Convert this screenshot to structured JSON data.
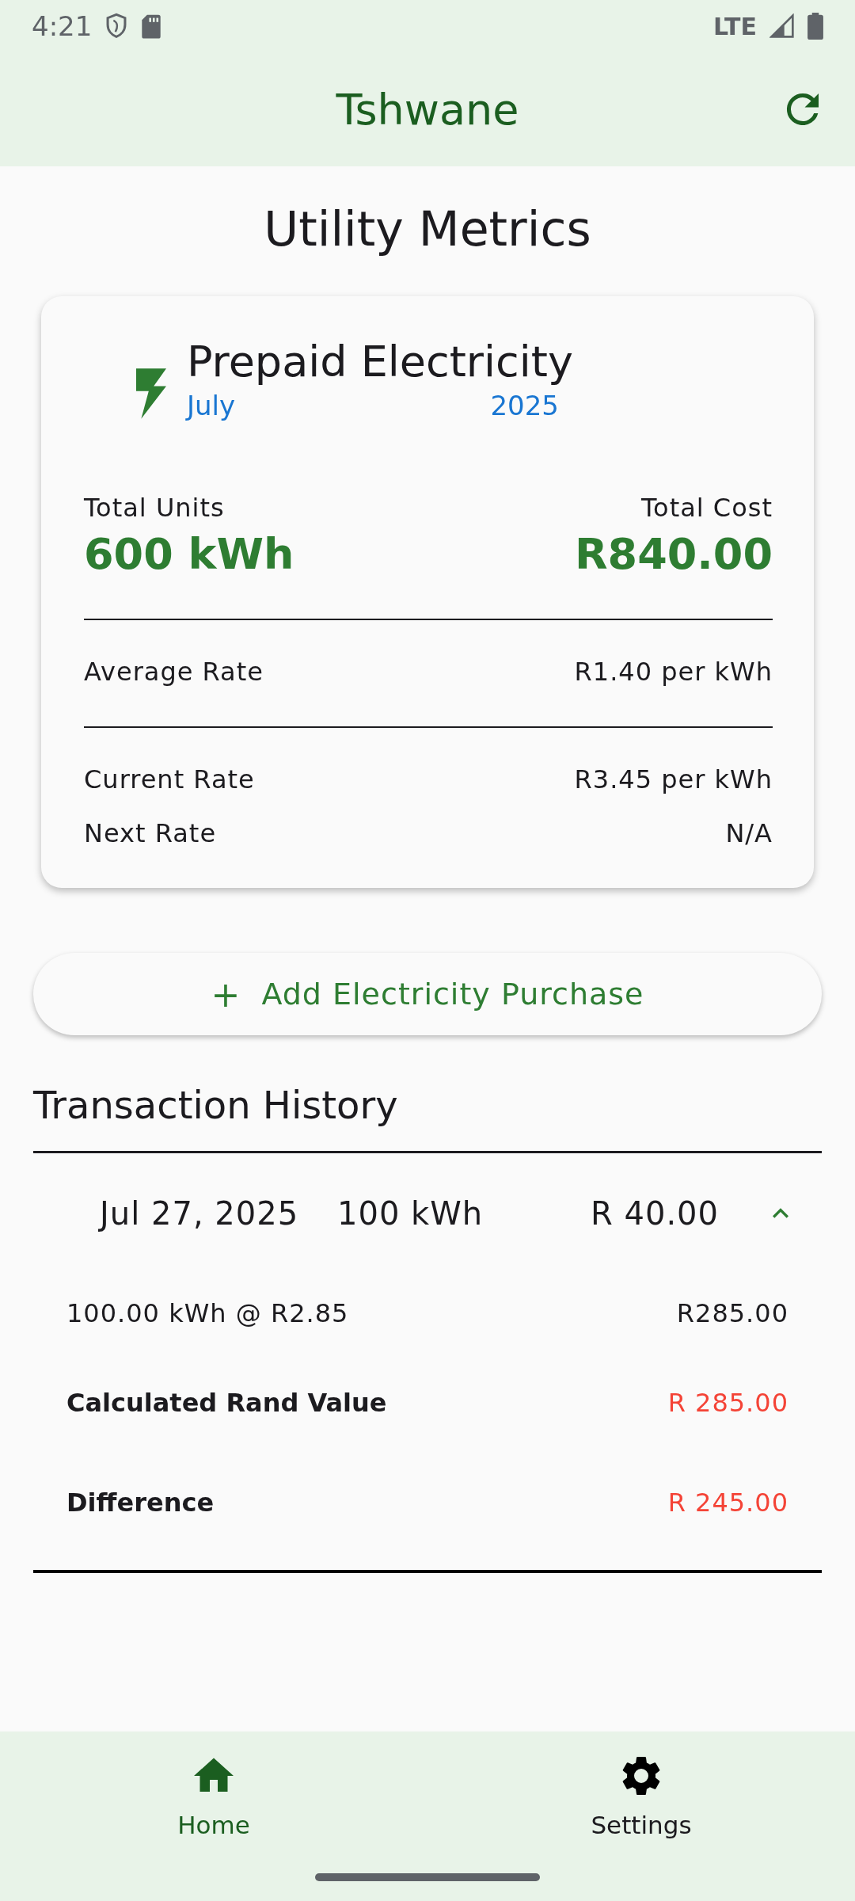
{
  "status_bar": {
    "time": "4:21",
    "network": "LTE"
  },
  "app_bar": {
    "title": "Tshwane"
  },
  "page_title": "Utility Metrics",
  "card": {
    "title": "Prepaid Electricity",
    "month": "July",
    "year": "2025",
    "totals": [
      {
        "label": "Total Units",
        "value": "600 kWh"
      },
      {
        "label": "Total Cost",
        "value": "R840.00"
      }
    ],
    "average": {
      "label": "Average Rate",
      "value": "R1.40 per kWh"
    },
    "rates": [
      {
        "label": "Current Rate",
        "value": "R3.45 per kWh"
      },
      {
        "label": "Next Rate",
        "value": "N/A"
      }
    ]
  },
  "add_button": {
    "icon": "+",
    "label": "Add Electricity Purchase"
  },
  "history": {
    "title": "Transaction History",
    "transactions": [
      {
        "date": "Jul 27, 2025",
        "units": "100 kWh",
        "amount": "R 40.00",
        "expanded": true,
        "breakdown": {
          "label": "100.00 kWh @ R2.85",
          "value": "R285.00"
        },
        "details": [
          {
            "label": "Calculated Rand Value",
            "value": "R 285.00"
          },
          {
            "label": "Difference",
            "value": "R 245.00"
          }
        ]
      }
    ]
  },
  "nav": [
    {
      "label": "Home",
      "kind": "home",
      "selected": true
    },
    {
      "label": "Settings",
      "kind": "settings",
      "selected": false
    }
  ]
}
